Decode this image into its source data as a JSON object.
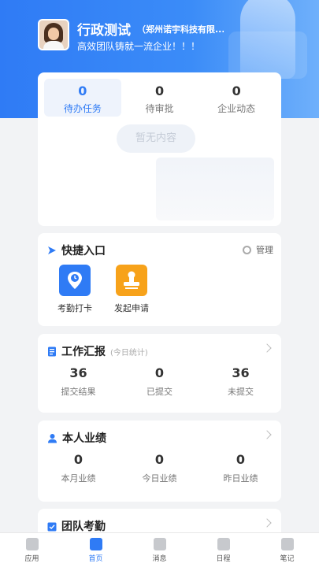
{
  "profile": {
    "name": "行政测试",
    "company": "（郑州诺宇科技有限...",
    "motto": "高效团队铸就一流企业！！！"
  },
  "tasks": {
    "tabs": [
      {
        "count": "0",
        "label": "待办任务"
      },
      {
        "count": "0",
        "label": "待审批"
      },
      {
        "count": "0",
        "label": "企业动态"
      }
    ],
    "empty_text": "暂无内容"
  },
  "quick_entry": {
    "title": "快捷入口",
    "manage_label": "管理",
    "items": [
      {
        "label": "考勤打卡",
        "icon": "clock-location-icon"
      },
      {
        "label": "发起申请",
        "icon": "stamp-icon"
      }
    ]
  },
  "work_report": {
    "title": "工作汇报",
    "subtitle": "(今日统计)",
    "stats": [
      {
        "value": "36",
        "label": "提交结果"
      },
      {
        "value": "0",
        "label": "已提交"
      },
      {
        "value": "36",
        "label": "未提交"
      }
    ]
  },
  "performance": {
    "title": "本人业绩",
    "stats": [
      {
        "value": "0",
        "label": "本月业绩"
      },
      {
        "value": "0",
        "label": "今日业绩"
      },
      {
        "value": "0",
        "label": "昨日业绩"
      }
    ]
  },
  "team_attendance": {
    "title": "团队考勤"
  },
  "nav": {
    "items": [
      {
        "label": "应用"
      },
      {
        "label": "首页"
      },
      {
        "label": "消息"
      },
      {
        "label": "日程"
      },
      {
        "label": "笔记"
      }
    ]
  },
  "colors": {
    "accent": "#2f7bf5",
    "header_gradient_end": "#6fb0fb",
    "quick_blue": "#2f7bf5",
    "quick_orange": "#f7a21a"
  }
}
